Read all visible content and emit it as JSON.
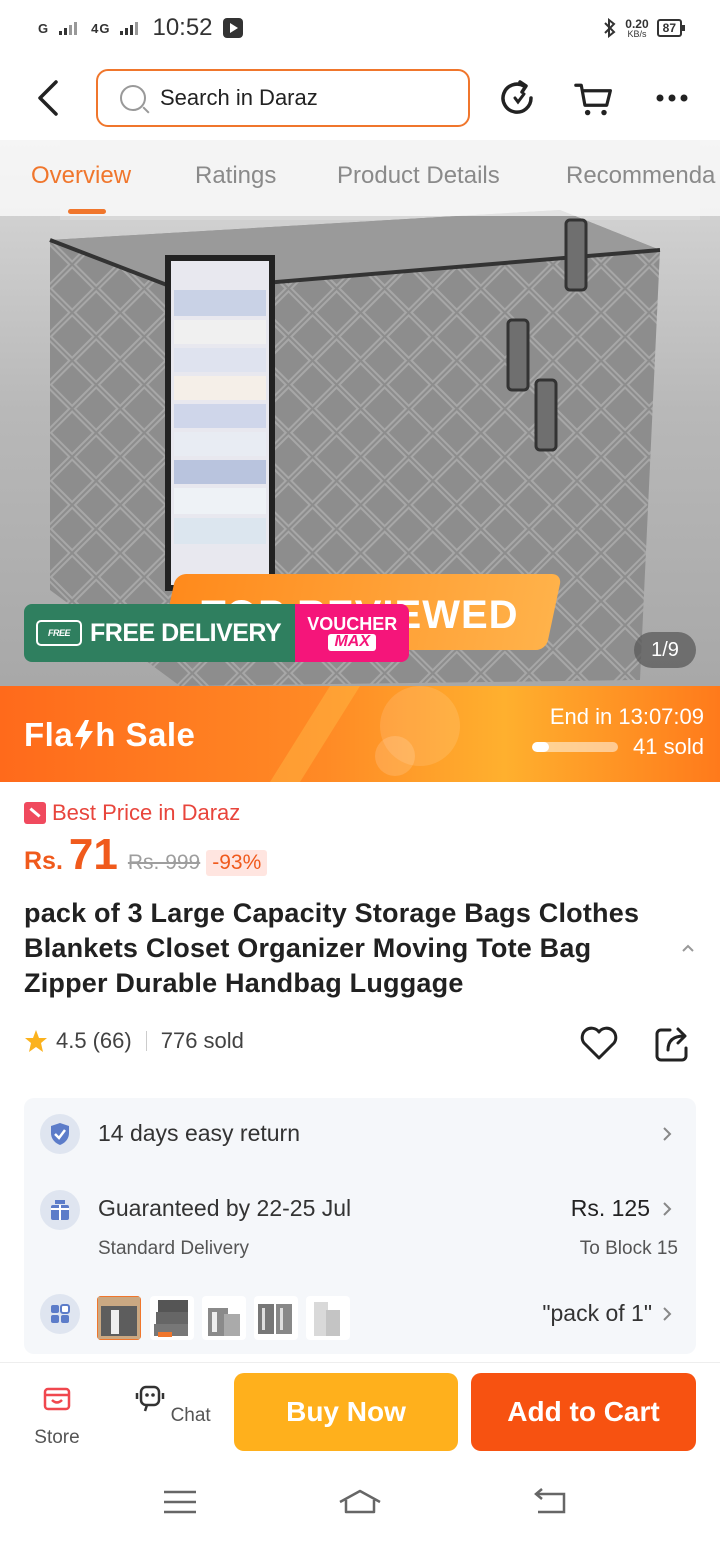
{
  "status_bar": {
    "signal_1": "G",
    "signal_2": "4G",
    "time": "10:52",
    "speed_value": "0.20",
    "speed_unit": "KB/s",
    "battery": "87"
  },
  "header": {
    "search_placeholder": "Search in Daraz"
  },
  "tabs": [
    {
      "label": "Overview",
      "active": true
    },
    {
      "label": "Ratings",
      "active": false
    },
    {
      "label": "Product Details",
      "active": false
    },
    {
      "label": "Recommenda",
      "active": false
    }
  ],
  "gallery": {
    "free_tag": "FREE",
    "free_delivery": "FREE DELIVERY",
    "voucher_line1": "VOUCHER",
    "voucher_line2": "MAX",
    "top_reviewed": "TOP REVIEWED",
    "pager": "1/9"
  },
  "flash_sale": {
    "title_a": "Fla",
    "title_b": "h  Sale",
    "end_label": "End in",
    "end_time": "13:07:09",
    "sold_text": "41 sold",
    "progress": 0.2
  },
  "price": {
    "badge": "Best Price in Daraz",
    "currency": "Rs.",
    "value": "71",
    "original": "Rs. 999",
    "discount": "-93%"
  },
  "product": {
    "title": "pack of 3 Large Capacity Storage Bags Clothes Blankets Closet Organizer Moving Tote Bag Zipper Durable Handbag Luggage",
    "rating": "4.5",
    "rating_count": "(66)",
    "sold": "776 sold"
  },
  "info": {
    "return_text": "14 days easy return",
    "delivery_text": "Guaranteed by 22-25 Jul",
    "delivery_sub": "Standard Delivery",
    "delivery_price": "Rs. 125",
    "delivery_to": "To Block 15",
    "variant_text": "\"pack of 1\""
  },
  "bottom_bar": {
    "store": "Store",
    "chat": "Chat",
    "buy_now": "Buy Now",
    "add_to_cart": "Add to Cart"
  },
  "colors": {
    "accent": "#f0762c",
    "buy_now": "#ffb01c",
    "add_to_cart": "#f75211",
    "price": "#f05a1c"
  },
  "icons": [
    "back-arrow-icon",
    "search-icon",
    "refresh-icon",
    "cart-icon",
    "more-icon",
    "star-icon",
    "heart-icon",
    "share-icon",
    "shield-check-icon",
    "gift-icon",
    "grid-icon",
    "chevron-right-icon",
    "store-icon",
    "chat-icon",
    "menu-icon",
    "home-icon",
    "back-nav-icon"
  ]
}
